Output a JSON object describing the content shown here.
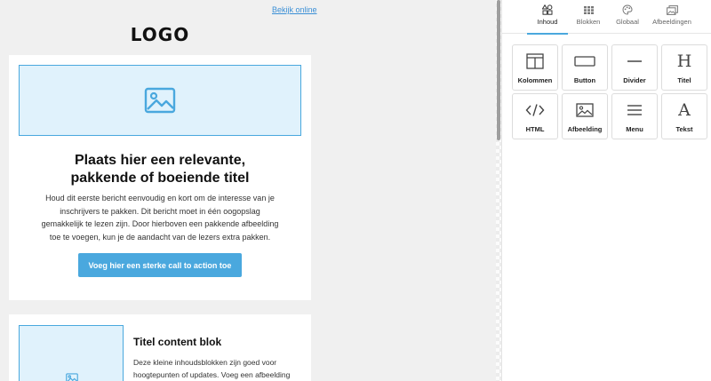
{
  "email": {
    "view_online": "Bekijk online",
    "logo": "LOGO",
    "hero": {
      "headline_line1": "Plaats hier een relevante,",
      "headline_line2": "pakkende of boeiende titel",
      "body_lines": [
        "Houd dit eerste bericht eenvoudig en kort om de interesse van je",
        "inschrijvers te pakken. Dit bericht moet in één oogopslag",
        "gemakkelijk te lezen zijn. Door hierboven een pakkende afbeelding",
        "toe te voegen, kun je de aandacht van de lezers extra pakken."
      ],
      "cta_label": "Voeg hier een sterke call to action toe",
      "image_icon": "image-icon"
    },
    "content_block": {
      "title": "Titel content blok",
      "body_lines": [
        "Deze kleine inhoudsblokken zijn goed voor",
        "hoogtepunten of updates. Voeg een afbeelding toe"
      ],
      "image_icon": "image-icon"
    }
  },
  "panel": {
    "tabs": [
      {
        "label": "Inhoud",
        "icon": "shapes-icon",
        "active": true
      },
      {
        "label": "Blokken",
        "icon": "grid-icon",
        "active": false
      },
      {
        "label": "Globaal",
        "icon": "palette-icon",
        "active": false
      },
      {
        "label": "Afbeeldingen",
        "icon": "images-icon",
        "active": false
      }
    ],
    "tiles": [
      {
        "label": "Kolommen",
        "icon": "columns-icon"
      },
      {
        "label": "Button",
        "icon": "button-icon"
      },
      {
        "label": "Divider",
        "icon": "divider-icon"
      },
      {
        "label": "Titel",
        "icon": "heading-icon",
        "glyph": "H"
      },
      {
        "label": "HTML",
        "icon": "code-icon",
        "glyph": "</>"
      },
      {
        "label": "Afbeelding",
        "icon": "image-icon"
      },
      {
        "label": "Menu",
        "icon": "menu-icon"
      },
      {
        "label": "Tekst",
        "icon": "text-icon",
        "glyph": "A"
      }
    ]
  },
  "colors": {
    "accent": "#4aa8de",
    "image_placeholder_bg": "#e0f2fc",
    "canvas_bg": "#f0f0f0"
  }
}
